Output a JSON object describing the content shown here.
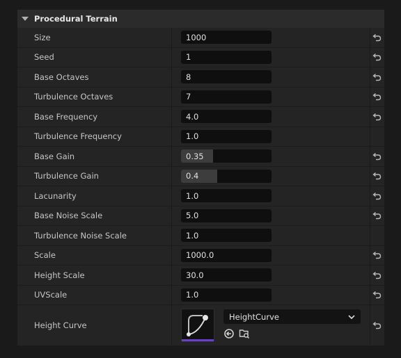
{
  "section": {
    "title": "Procedural Terrain"
  },
  "properties": [
    {
      "label": "Size",
      "value": "1000",
      "resettable": true
    },
    {
      "label": "Seed",
      "value": "1",
      "resettable": true
    },
    {
      "label": "Base Octaves",
      "value": "8",
      "resettable": true
    },
    {
      "label": "Turbulence Octaves",
      "value": "7",
      "resettable": true
    },
    {
      "label": "Base Frequency",
      "value": "4.0",
      "resettable": true
    },
    {
      "label": "Turbulence Frequency",
      "value": "1.0",
      "resettable": false
    },
    {
      "label": "Base Gain",
      "value": "0.35",
      "fill": 0.35,
      "resettable": true
    },
    {
      "label": "Turbulence Gain",
      "value": "0.4",
      "fill": 0.4,
      "resettable": true
    },
    {
      "label": "Lacunarity",
      "value": "1.0",
      "resettable": true
    },
    {
      "label": "Base Noise Scale",
      "value": "5.0",
      "resettable": true
    },
    {
      "label": "Turbulence Noise Scale",
      "value": "1.0",
      "resettable": false
    },
    {
      "label": "Scale",
      "value": "1000.0",
      "resettable": true
    },
    {
      "label": "Height Scale",
      "value": "30.0",
      "resettable": true
    },
    {
      "label": "UVScale",
      "value": "1.0",
      "resettable": true
    }
  ],
  "height_curve": {
    "label": "Height Curve",
    "asset": "HeightCurve",
    "icons": [
      "use-selected-icon",
      "browse-asset-icon"
    ]
  },
  "colors": {
    "accent": "#6a3fd0",
    "background": "#1a1a1a",
    "row": "#242424"
  }
}
